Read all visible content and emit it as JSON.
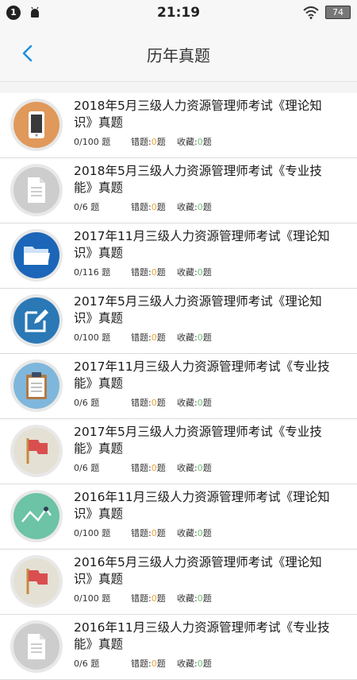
{
  "status": {
    "notification_count": "1",
    "time": "21:19",
    "battery": "74"
  },
  "nav": {
    "title": "历年真题"
  },
  "labels": {
    "unit": "题",
    "wrong": "错题:",
    "fav": "收藏:"
  },
  "items": [
    {
      "title": "2018年5月三级人力资源管理师考试《理论知识》真题",
      "progress": "0/100",
      "wrong": "0",
      "fav": "0",
      "icon": "phone-icon",
      "bg": "#e0995a"
    },
    {
      "title": "2018年5月三级人力资源管理师考试《专业技能》真题",
      "progress": "0/6",
      "wrong": "0",
      "fav": "0",
      "icon": "document-icon",
      "bg": "#cdcdcd"
    },
    {
      "title": "2017年11月三级人力资源管理师考试《理论知识》真题",
      "progress": "0/116",
      "wrong": "0",
      "fav": "0",
      "icon": "folder-icon",
      "bg": "#1b66b8"
    },
    {
      "title": "2017年5月三级人力资源管理师考试《理论知识》真题",
      "progress": "0/100",
      "wrong": "0",
      "fav": "0",
      "icon": "edit-icon",
      "bg": "#2a78b6"
    },
    {
      "title": "2017年11月三级人力资源管理师考试《专业技能》真题",
      "progress": "0/6",
      "wrong": "0",
      "fav": "0",
      "icon": "clipboard-icon",
      "bg": "#7fb7dc"
    },
    {
      "title": "2017年5月三级人力资源管理师考试《专业技能》真题",
      "progress": "0/6",
      "wrong": "0",
      "fav": "0",
      "icon": "flag-icon",
      "bg": "#e4e0d4"
    },
    {
      "title": "2016年11月三级人力资源管理师考试《理论知识》真题",
      "progress": "0/100",
      "wrong": "0",
      "fav": "0",
      "icon": "chart-line-icon",
      "bg": "#6cc3a5"
    },
    {
      "title": "2016年5月三级人力资源管理师考试《理论知识》真题",
      "progress": "0/100",
      "wrong": "0",
      "fav": "0",
      "icon": "flag-icon",
      "bg": "#e4e0d4"
    },
    {
      "title": "2016年11月三级人力资源管理师考试《专业技能》真题",
      "progress": "0/6",
      "wrong": "0",
      "fav": "0",
      "icon": "document-icon",
      "bg": "#cdcdcd"
    }
  ]
}
